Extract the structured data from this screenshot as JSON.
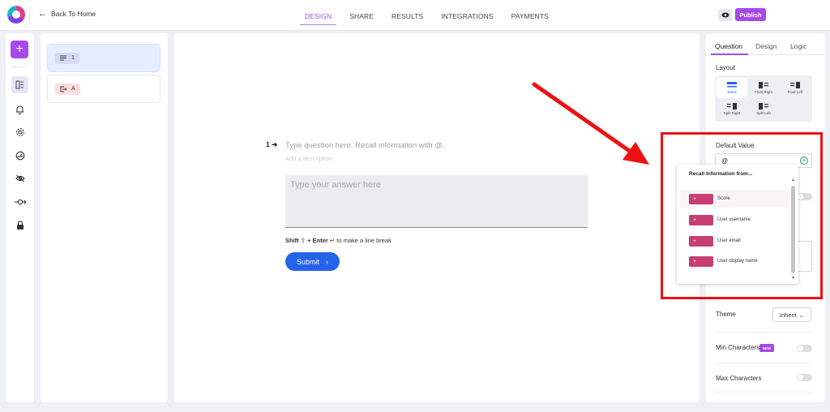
{
  "header": {
    "back_label": "Back To Home",
    "tabs": [
      {
        "label": "DESIGN",
        "active": true
      },
      {
        "label": "SHARE",
        "active": false
      },
      {
        "label": "RESULTS",
        "active": false
      },
      {
        "label": "INTEGRATIONS",
        "active": false
      },
      {
        "label": "PAYMENTS",
        "active": false
      }
    ],
    "publish_label": "Publish"
  },
  "sidebar": {
    "add_label": "+",
    "icons": [
      "layout-icon",
      "bell-icon",
      "gear-icon",
      "speedometer-icon",
      "eye-off-icon",
      "flow-icon",
      "lock-icon"
    ]
  },
  "questions": [
    {
      "tag": "1",
      "icon": "text-lines-icon",
      "active": true
    },
    {
      "tag": "A",
      "icon": "exit-icon",
      "active": false
    }
  ],
  "canvas": {
    "question_number": "1",
    "question_placeholder": "Type question here. Recall information with @.",
    "description_placeholder": "Add a description",
    "answer_placeholder": "Type your answer here",
    "hint_key1": "Shift",
    "hint_plus": "+",
    "hint_key2": "Enter",
    "hint_text": "to make a line break",
    "submit_label": "Submit"
  },
  "right_panel": {
    "tabs": [
      {
        "label": "Question",
        "active": true
      },
      {
        "label": "Design",
        "active": false
      },
      {
        "label": "Logic",
        "active": false
      }
    ],
    "layout_label": "Layout",
    "layout_options": [
      {
        "label": "Stack",
        "active": true
      },
      {
        "label": "Float Right",
        "active": false
      },
      {
        "label": "Float Left",
        "active": false
      },
      {
        "label": "Split Right",
        "active": false
      },
      {
        "label": "Split Left",
        "active": false
      }
    ],
    "default_value_label": "Default Value",
    "default_value": "@",
    "theme_label": "Theme",
    "theme_value": "Inherit",
    "min_chars_label": "Min Characters",
    "new_badge": "NEW",
    "max_chars_label": "Max Characters"
  },
  "recall_dropdown": {
    "title": "Recall Information from...",
    "items": [
      {
        "label": "Score",
        "chip": "+"
      },
      {
        "label": "User username",
        "chip": "+"
      },
      {
        "label": "User email",
        "chip": "+"
      },
      {
        "label": "User display name",
        "chip": "+"
      }
    ]
  },
  "colors": {
    "accent_purple": "#a848e8",
    "submit_blue": "#2563eb",
    "recall_chip": "#c83e73",
    "annotation_red": "#ee1111"
  }
}
